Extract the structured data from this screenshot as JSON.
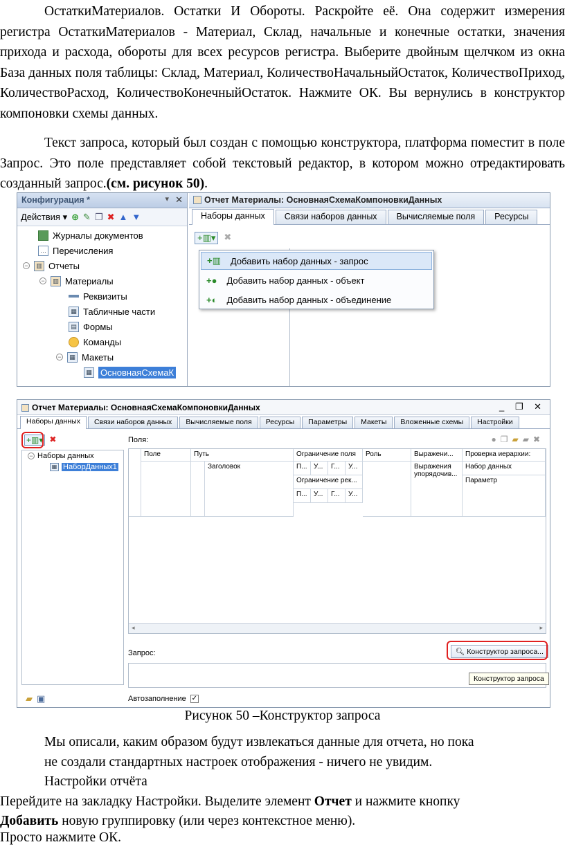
{
  "paragraph1": "ОстаткиМатериалов. Остатки И Обороты. Раскройте её. Она содержит измерения регистра ОстаткиМатериалов - Материал, Склад, начальные и конечные остатки, значения прихода и расхода, обороты для всех ресурсов регистра. Выберите двойным щелчком из окна База данных поля таблицы: Склад, Материал, КоличествоНачальныйОстаток, КоличествоПриход, КоличествоРасход, КоличествоКонечныйОстаток. Нажмите ОК. Вы вернулись в конструктор компоновки схемы данных.",
  "paragraph2_text": "Текст запроса, который был создан с помощью конструктора, платформа поместит в поле Запрос. Это поле представляет собой текстовый редактор, в котором можно отредактировать созданный запрос.",
  "paragraph2_ref": "(см. рисунок 50)",
  "paragraph2_end": ".",
  "shot1": {
    "config_title": "Конфигурация *",
    "actions_label": "Действия",
    "tree": [
      "Журналы документов",
      "Перечисления",
      "Отчеты",
      "Материалы",
      "Реквизиты",
      "Табличные части",
      "Формы",
      "Команды",
      "Макеты",
      "ОсновнаяСхемаК"
    ],
    "window_title": "Отчет Материалы: ОсновнаяСхемаКомпоновкиДанных",
    "tabs": [
      "Наборы данных",
      "Связи наборов данных",
      "Вычисляемые поля",
      "Ресурсы"
    ],
    "menu": [
      "Добавить набор данных - запрос",
      "Добавить набор данных - объект",
      "Добавить набор данных - объединение"
    ]
  },
  "shot2": {
    "window_title": "Отчет Материалы: ОсновнаяСхемаКомпоновкиДанных",
    "tabs": [
      "Наборы данных",
      "Связи наборов данных",
      "Вычисляемые поля",
      "Ресурсы",
      "Параметры",
      "Макеты",
      "Вложенные схемы",
      "Настройки"
    ],
    "tree_root": "Наборы данных",
    "tree_item": "НаборДанных1",
    "fields_label": "Поля:",
    "columns": [
      "Поле",
      "Путь",
      "Ограничение поля",
      "Роль",
      "Выражени...",
      "Проверка иерархии:"
    ],
    "row_path": "Заголовок",
    "short_cells": [
      "П...",
      "У...",
      "Г...",
      "У..."
    ],
    "restriction2": "Ограничение рек...",
    "expr2": "Выражения упорядочив...",
    "check_items": [
      "Набор данных",
      "Параметр"
    ],
    "query_label": "Запрос:",
    "query_button": "Конструктор запроса...",
    "tooltip": "Конструктор запроса",
    "autofill": "Автозаполнение"
  },
  "caption": "Рисунок 50 –Конструктор запроса",
  "p3_line1": "Мы описали, каким образом будут извлекаться данные для отчета, но пока",
  "p3_line2": "не создали стандартных настроек отображения - ничего не увидим.",
  "p3_line3": "Настройки отчёта",
  "p4_pre": "Перейдите на закладку Настройки. Выделите элемент ",
  "p4_bold1": "Отчет",
  "p4_mid": " и нажмите кнопку",
  "p4_bold2": "Добавить",
  "p4_post": " новую группировку (или через контекстное меню).",
  "p5": "Просто нажмите ОК."
}
